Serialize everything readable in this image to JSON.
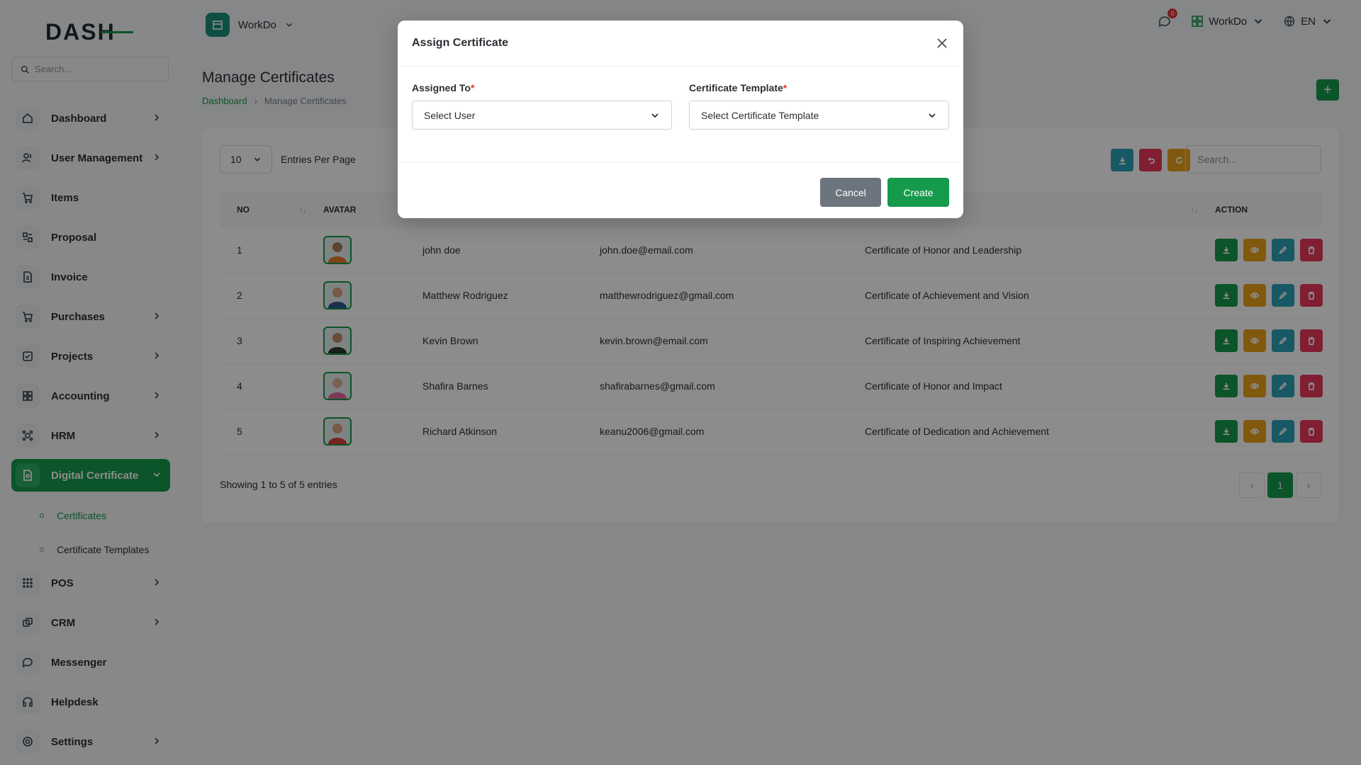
{
  "app": {
    "logo_text": "DASH"
  },
  "sidebar": {
    "search_placeholder": "Search...",
    "items": [
      {
        "label": "Dashboard",
        "icon": "home-icon",
        "has_children": true
      },
      {
        "label": "User Management",
        "icon": "users-icon",
        "has_children": true
      },
      {
        "label": "Items",
        "icon": "cart-icon",
        "has_children": false
      },
      {
        "label": "Proposal",
        "icon": "proposal-icon",
        "has_children": false
      },
      {
        "label": "Invoice",
        "icon": "file-icon",
        "has_children": false
      },
      {
        "label": "Purchases",
        "icon": "cart-icon",
        "has_children": true
      },
      {
        "label": "Projects",
        "icon": "check-square-icon",
        "has_children": true
      },
      {
        "label": "Accounting",
        "icon": "grid-icon",
        "has_children": true
      },
      {
        "label": "HRM",
        "icon": "hrm-icon",
        "has_children": true
      },
      {
        "label": "Digital Certificate",
        "icon": "certificate-icon",
        "has_children": true,
        "active": true
      }
    ],
    "sub_items": [
      {
        "label": "Certificates",
        "active": true
      },
      {
        "label": "Certificate Templates",
        "active": false
      }
    ],
    "items_after": [
      {
        "label": "POS",
        "icon": "dots-grid-icon",
        "has_children": true
      },
      {
        "label": "CRM",
        "icon": "layers-icon",
        "has_children": true
      },
      {
        "label": "Messenger",
        "icon": "chat-icon",
        "has_children": false
      },
      {
        "label": "Helpdesk",
        "icon": "headset-icon",
        "has_children": false
      },
      {
        "label": "Settings",
        "icon": "gear-icon",
        "has_children": true
      }
    ]
  },
  "topbar": {
    "workspace": "WorkDo",
    "notifications_count": "0",
    "company": "WorkDo",
    "language": "EN"
  },
  "page": {
    "title": "Manage Certificates",
    "breadcrumb": [
      "Dashboard",
      "Manage Certificates"
    ]
  },
  "table": {
    "entries_value": "10",
    "entries_label": "Entries Per Page",
    "search_placeholder": "Search...",
    "columns": [
      "NO",
      "AVATAR",
      "",
      "",
      "",
      "ACTION"
    ],
    "rows": [
      {
        "no": "1",
        "name": "john doe",
        "email": "john.doe@email.com",
        "certificate": "Certificate of Honor and Leadership"
      },
      {
        "no": "2",
        "name": "Matthew Rodriguez",
        "email": "matthewrodriguez@gmail.com",
        "certificate": "Certificate of Achievement and Vision"
      },
      {
        "no": "3",
        "name": "Kevin Brown",
        "email": "kevin.brown@email.com",
        "certificate": "Certificate of Inspiring Achievement"
      },
      {
        "no": "4",
        "name": "Shafira Barnes",
        "email": "shafirabarnes@gmail.com",
        "certificate": "Certificate of Honor and Impact"
      },
      {
        "no": "5",
        "name": "Richard Atkinson",
        "email": "keanu2006@gmail.com",
        "certificate": "Certificate of Dedication and Achievement"
      }
    ],
    "showing": "Showing 1 to 5 of 5 entries",
    "current_page": "1"
  },
  "modal": {
    "title": "Assign Certificate",
    "assigned_to_label": "Assigned To",
    "assigned_to_value": "Select User",
    "template_label": "Certificate Template",
    "template_value": "Select Certificate Template",
    "required_mark": "*",
    "cancel": "Cancel",
    "create": "Create"
  },
  "colors": {
    "primary": "#169a4c",
    "warning": "#e9a21a",
    "info": "#2aa3b8",
    "danger": "#e83a5a"
  }
}
